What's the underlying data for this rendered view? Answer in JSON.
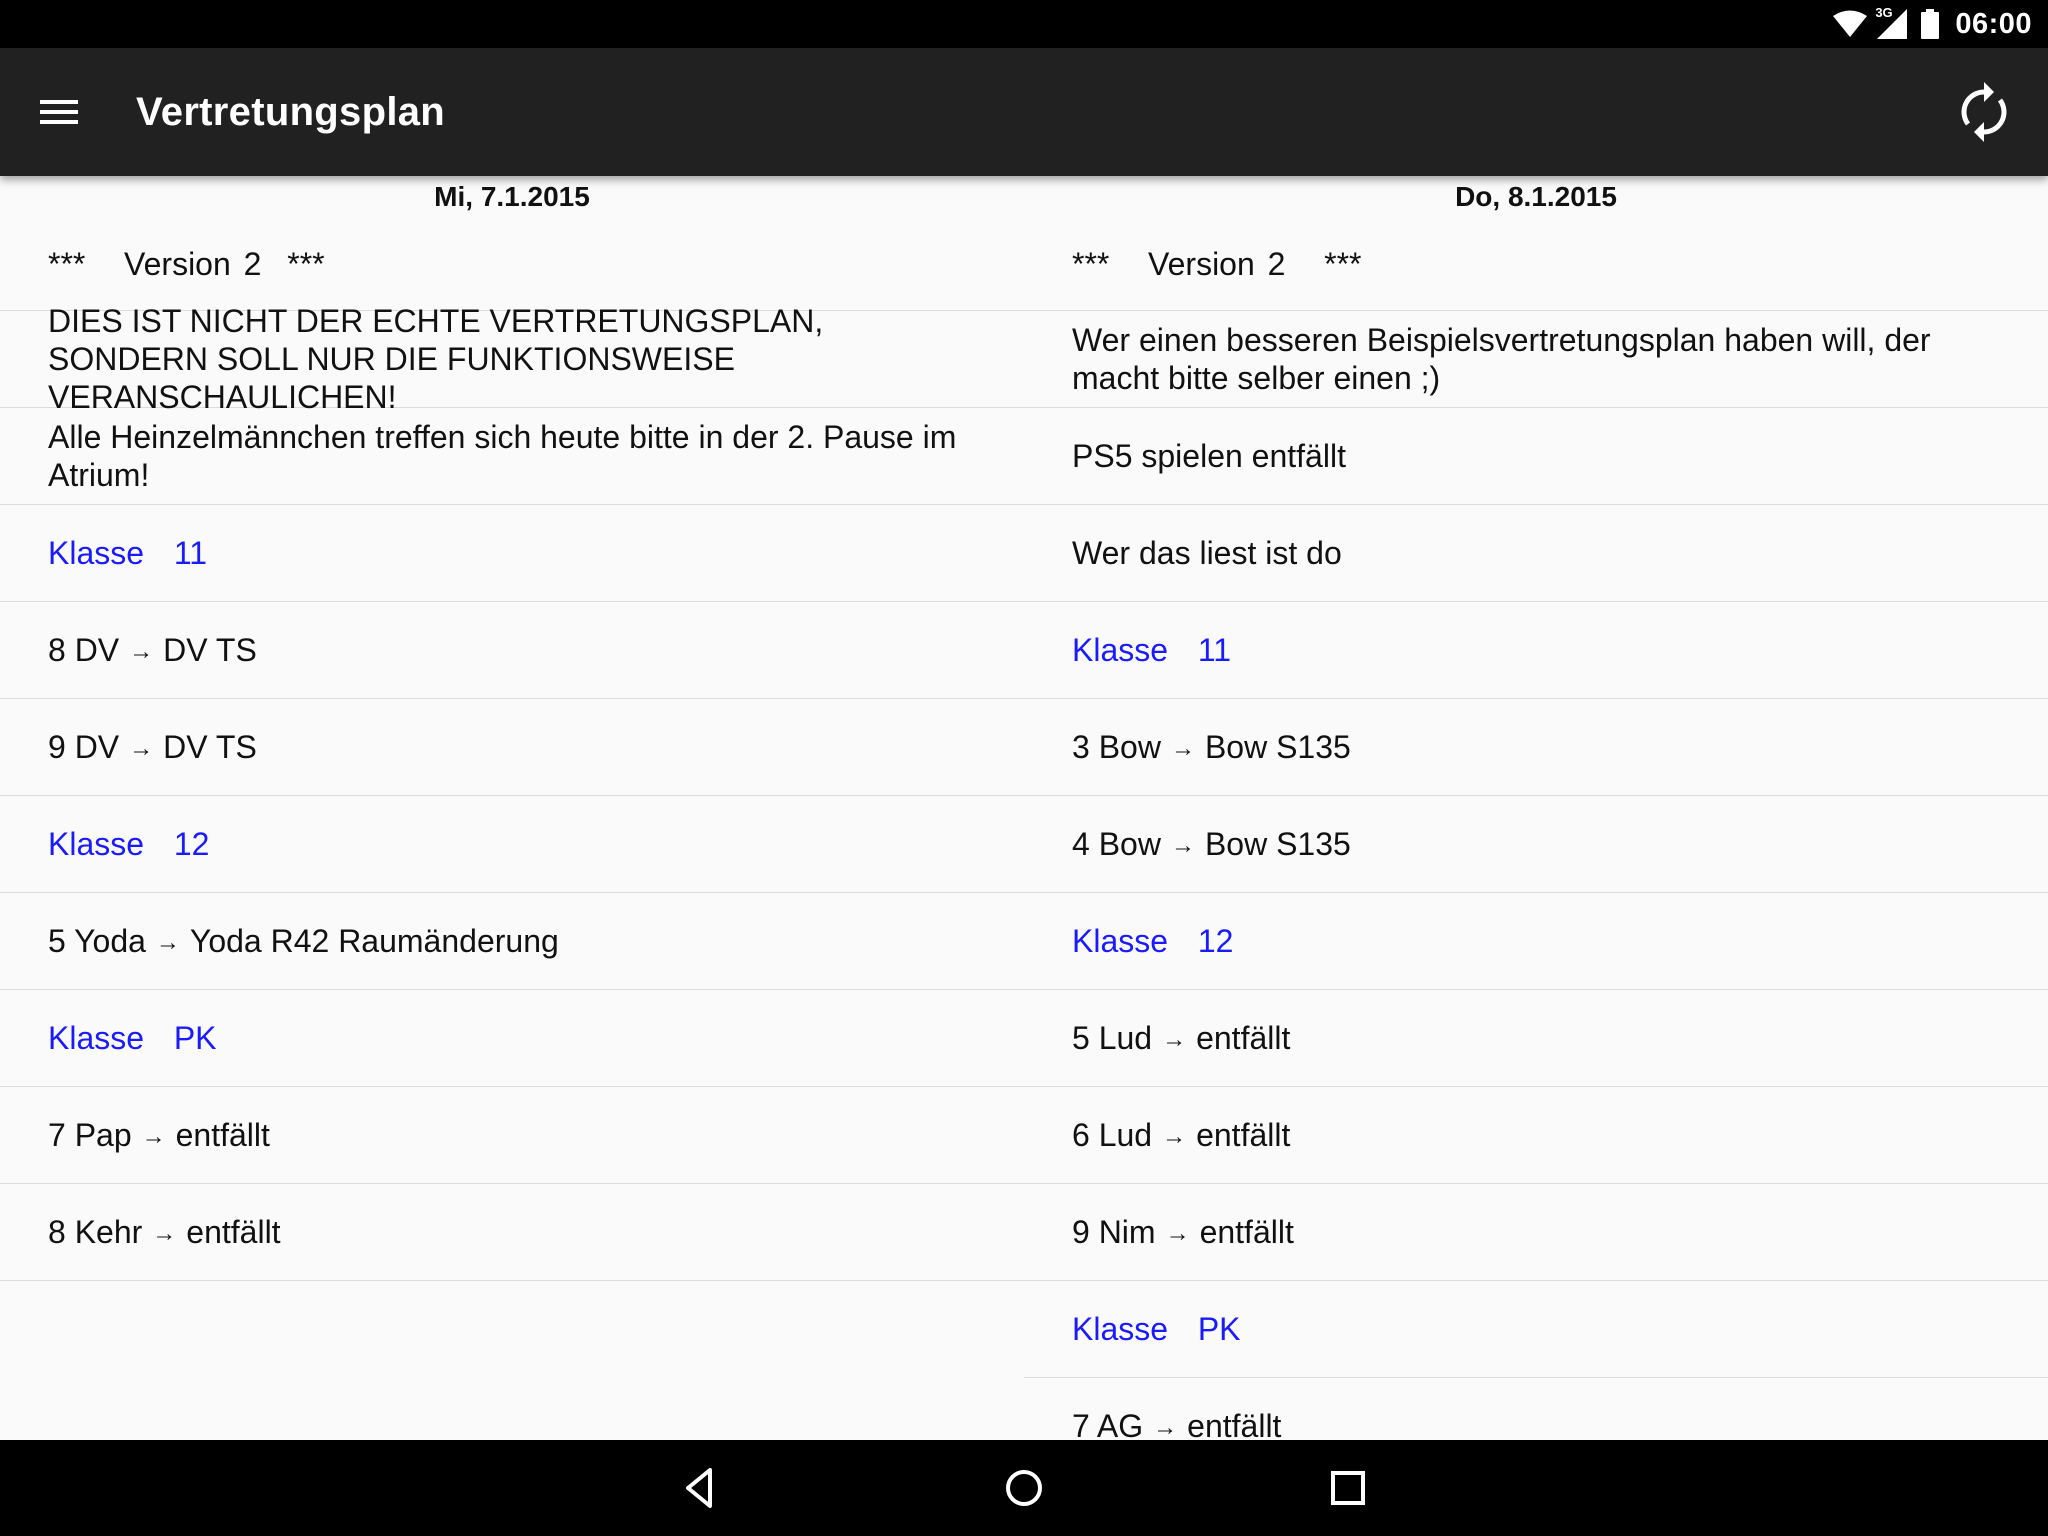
{
  "status_bar": {
    "network": "3G",
    "time": "06:00",
    "icons": [
      "wifi-icon",
      "cell-signal-icon",
      "battery-icon"
    ]
  },
  "toolbar": {
    "title": "Vertretungsplan",
    "menu_icon": "hamburger-menu-icon",
    "refresh_icon": "refresh-icon"
  },
  "colors": {
    "toolbar_bg": "#212121",
    "status_bg": "#000000",
    "klasse_link": "#1a1aff",
    "background": "#fafafa"
  },
  "columns": [
    {
      "date": "Mi, 7.1.2015",
      "header": "***   Version 2  ***",
      "rows": [
        {
          "type": "text",
          "text": "DIES IST NICHT DER ECHTE VERTRETUNGSPLAN, SONDERN SOLL NUR DIE FUNKTIONSWEISE VERANSCHAULICHEN!"
        },
        {
          "type": "text",
          "text": "Alle Heinzelmännchen treffen sich heute bitte in der 2. Pause im Atrium!"
        },
        {
          "type": "klasse",
          "text": "Klasse  11"
        },
        {
          "type": "entry",
          "from": "8 DV",
          "to": "DV TS"
        },
        {
          "type": "entry",
          "from": "9 DV",
          "to": "DV TS"
        },
        {
          "type": "klasse",
          "text": "Klasse  12"
        },
        {
          "type": "entry",
          "from": "5 Yoda",
          "to": "Yoda R42 Raumänderung"
        },
        {
          "type": "klasse",
          "text": "Klasse  PK"
        },
        {
          "type": "entry",
          "from": "7 Pap",
          "to": "entfällt"
        },
        {
          "type": "entry",
          "from": "8 Kehr",
          "to": "entfällt"
        }
      ]
    },
    {
      "date": "Do, 8.1.2015",
      "header": "***   Version 2   ***",
      "rows": [
        {
          "type": "text",
          "text": "Wer einen besseren Beispielsvertretungsplan haben will, der macht bitte selber einen ;)"
        },
        {
          "type": "text",
          "text": "PS5 spielen entfällt"
        },
        {
          "type": "text",
          "text": "Wer das liest ist do"
        },
        {
          "type": "klasse",
          "text": "Klasse  11"
        },
        {
          "type": "entry",
          "from": "3 Bow",
          "to": "Bow S135"
        },
        {
          "type": "entry",
          "from": "4 Bow",
          "to": "Bow S135"
        },
        {
          "type": "klasse",
          "text": "Klasse  12"
        },
        {
          "type": "entry",
          "from": "5 Lud",
          "to": "entfällt"
        },
        {
          "type": "entry",
          "from": "6 Lud",
          "to": "entfällt"
        },
        {
          "type": "entry",
          "from": "9 Nim",
          "to": "entfällt"
        },
        {
          "type": "klasse",
          "text": "Klasse  PK"
        },
        {
          "type": "entry",
          "from": "7 AG",
          "to": "entfällt"
        }
      ]
    }
  ],
  "arrow_glyph": "→",
  "nav_bar": {
    "buttons": [
      "back-icon",
      "home-icon",
      "recents-icon"
    ]
  }
}
